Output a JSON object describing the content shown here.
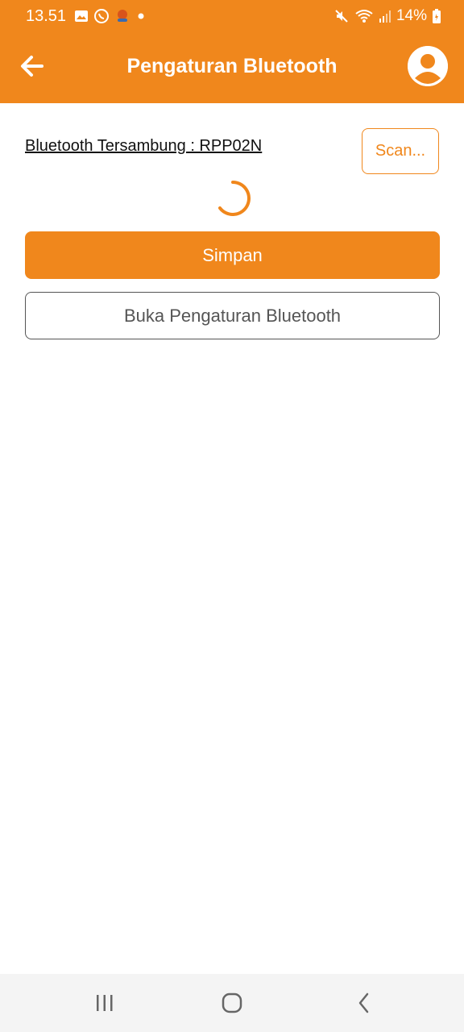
{
  "status_bar": {
    "time": "13.51",
    "battery": "14%",
    "icons_left": [
      "gallery-icon",
      "whatsapp-icon",
      "app-notification-icon",
      "dot-icon"
    ],
    "icons_right": [
      "mute-icon",
      "wifi-icon",
      "signal-icon",
      "battery-icon"
    ]
  },
  "app_bar": {
    "title": "Pengaturan Bluetooth",
    "back_icon": "arrow-left-icon",
    "profile_icon": "user-avatar-icon"
  },
  "content": {
    "connected_label": "Bluetooth Tersambung : RPP02N",
    "scan_label": "Scan...",
    "save_label": "Simpan",
    "open_settings_label": "Buka Pengaturan Bluetooth"
  },
  "nav_bar": {
    "items": [
      "recents-icon",
      "home-icon",
      "back-icon"
    ]
  },
  "colors": {
    "accent": "#f0871c",
    "text_dark": "#111111",
    "border_gray": "#555555"
  }
}
